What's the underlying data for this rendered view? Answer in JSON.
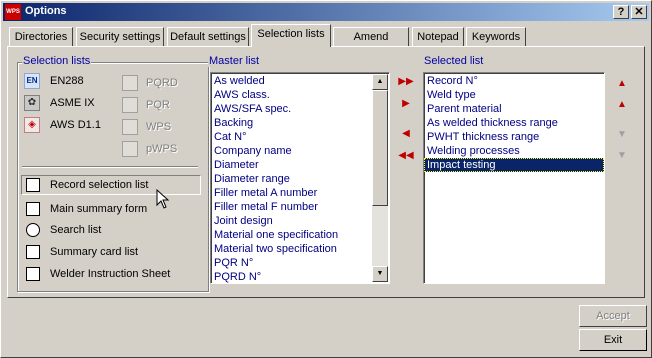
{
  "window": {
    "title": "Options",
    "app_icon_text": "WPS",
    "help_label": "?",
    "close_label": "✕"
  },
  "tabs": [
    "Directories",
    "Security settings",
    "Default settings",
    "Selection lists",
    "Amend menus",
    "Notepad",
    "Keywords"
  ],
  "active_tab": "Selection lists",
  "selection_lists": {
    "title": "Selection lists",
    "standards": [
      {
        "icon_text": "EN",
        "label": "EN288"
      },
      {
        "icon_text": "✿",
        "label": "ASME IX"
      },
      {
        "icon_text": "◈",
        "label": "AWS D1.1"
      }
    ],
    "doc_types": [
      "PQRD",
      "PQR",
      "WPS",
      "pWPS"
    ],
    "forms": [
      "Record selection list",
      "Main summary form",
      "Search list",
      "Summary card list",
      "Welder Instruction Sheet"
    ]
  },
  "master_list": {
    "title": "Master list",
    "items": [
      "As welded",
      "AWS class.",
      "AWS/SFA spec.",
      "Backing",
      "Cat N°",
      "Company name",
      "Diameter",
      "Diameter range",
      "Filler metal A number",
      "Filler metal F number",
      "Joint design",
      "Material one specification",
      "Material two specification",
      "PQR N°",
      "PQRD N°"
    ]
  },
  "selected_list": {
    "title": "Selected list",
    "items": [
      "Record N°",
      "Weld type",
      "Parent material",
      "As welded thickness range",
      "PWHT thickness range",
      "Welding processes",
      "Impact testing"
    ],
    "selected_index": 6
  },
  "buttons": {
    "accept": "Accept",
    "exit": "Exit"
  }
}
